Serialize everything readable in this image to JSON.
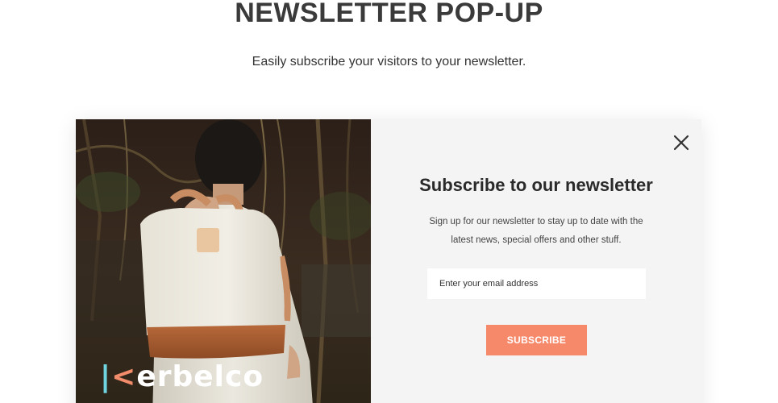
{
  "hero": {
    "title": "NEWSLETTER POP-UP",
    "subtitle": "Easily subscribe your visitors to your newsletter."
  },
  "popup": {
    "heading": "Subscribe to our newsletter",
    "description": "Sign up for our newsletter to stay up to date with the latest news, special offers and other stuff.",
    "email_placeholder": "Enter your email address",
    "subscribe_label": "SUBSCRIBE",
    "close_icon": "close-icon",
    "image": {
      "subject": "person-with-backpack-photo",
      "brand_logo": "Kerbelco"
    }
  },
  "colors": {
    "accent": "#f7896b",
    "panel_bg": "#f4f4f4",
    "heading_text": "#2a2a2a",
    "logo_k_left": "#6fd3e0",
    "logo_k_right": "#f28c6a"
  }
}
